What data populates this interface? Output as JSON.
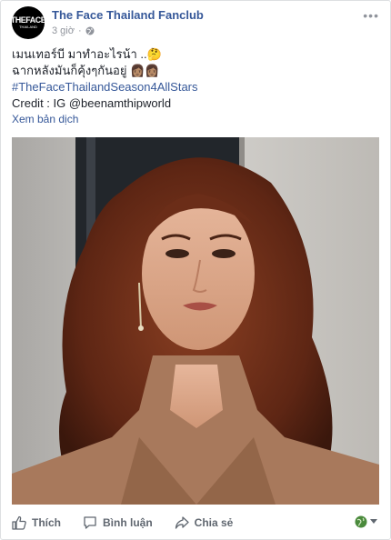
{
  "page": {
    "name": "The Face Thailand Fanclub",
    "time": "3 giờ",
    "logo_main": "THEFACE",
    "logo_sub": "THAILAND"
  },
  "post": {
    "line1": "เมนเทอร์บี มาทำอะไรน้า ..🤔",
    "line2": "ฉากหลังมันก็คุ้งๆกันอยู่ 👩🏽👩🏽",
    "hashtag": "#TheFaceThailandSeason4AllStars",
    "credit": "Credit : IG @beenamthipworld",
    "translate": "Xem bản dịch"
  },
  "actions": {
    "like": "Thích",
    "comment": "Bình luận",
    "share": "Chia sẻ"
  },
  "icons": [
    "globe-icon",
    "more-icon",
    "like-icon",
    "comment-icon",
    "share-icon",
    "audience-globe-icon",
    "chevron-down-icon"
  ],
  "colors": {
    "link": "#365899",
    "meta": "#90949c",
    "action": "#606770"
  }
}
